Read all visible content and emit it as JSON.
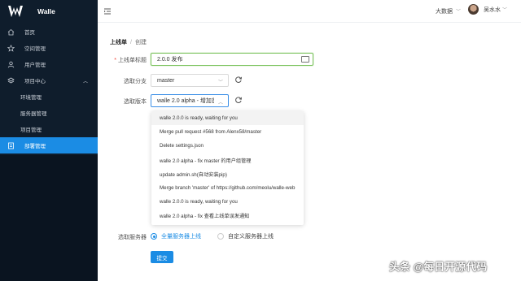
{
  "app": {
    "name": "Walle"
  },
  "sidebar": {
    "items": [
      {
        "label": "首页",
        "icon": "home-icon"
      },
      {
        "label": "空间管理",
        "icon": "star-icon"
      },
      {
        "label": "用户管理",
        "icon": "user-icon"
      },
      {
        "label": "项目中心",
        "icon": "layers-icon"
      },
      {
        "label": "环境管理"
      },
      {
        "label": "服务器管理"
      },
      {
        "label": "项目管理"
      },
      {
        "label": "部署管理",
        "icon": "deploy-icon"
      }
    ]
  },
  "header": {
    "space": "大数据",
    "user": "吴水水"
  },
  "breadcrumb": {
    "root": "上线单",
    "sep": "/",
    "current": "创建"
  },
  "form": {
    "title_label": "上线单标题",
    "title_value": "2.0.0 发布",
    "branch_label": "选取分支",
    "branch_value": "master",
    "version_label": "选取版本",
    "version_value": "walle 2.0 alpha - 增加首",
    "server_label": "选取服务器",
    "server_opt1": "全量服务器上线",
    "server_opt2": "自定义服务器上线",
    "submit": "提交"
  },
  "dropdown": {
    "options": [
      "walle 2.0.0 is ready, waiting for you",
      "Merge pull request #568 from Alenx58/master",
      "Delete settings.json",
      "walle 2.0 alpha - fix master 的用户组管理",
      "update admin.sh(自动安装pip)",
      "Merge branch 'master' of https://github.com/meolu/walle-web",
      "walle 2.0.0 is ready, waiting for you",
      "walle 2.0 alpha - fix 查看上线单误发通知"
    ]
  },
  "watermark": "头条 @每日开源代码",
  "colors": {
    "sidebar": "#0f1d2c",
    "accent": "#1b8ce4",
    "focus": "#7ac25c"
  }
}
